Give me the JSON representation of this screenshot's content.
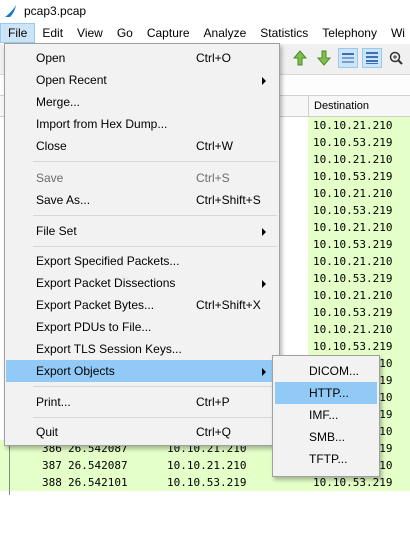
{
  "window": {
    "title": "pcap3.pcap"
  },
  "menubar": {
    "items": [
      "File",
      "Edit",
      "View",
      "Go",
      "Capture",
      "Analyze",
      "Statistics",
      "Telephony",
      "Wi"
    ],
    "active_index": 0
  },
  "packet_list": {
    "destination_header": "Destination",
    "destinations": [
      "10.10.21.210",
      "10.10.53.219",
      "10.10.21.210",
      "10.10.53.219",
      "10.10.21.210",
      "10.10.53.219",
      "10.10.21.210",
      "10.10.53.219",
      "10.10.21.210",
      "10.10.53.219",
      "10.10.21.210",
      "10.10.53.219",
      "10.10.21.210",
      "10.10.53.219",
      "10.10.21.210",
      "10.10.53.219",
      "10.10.21.210",
      "10.10.53.219",
      "10.10.21.210",
      "10.10.53.219",
      "10.10.21.210"
    ],
    "visible_rows": [
      {
        "no": "386",
        "time": "26.542087",
        "source": "10.10.21.210"
      },
      {
        "no": "387",
        "time": "26.542087",
        "source": "10.10.21.210"
      },
      {
        "no": "388",
        "time": "26.542101",
        "source": "10.10.53.219"
      }
    ],
    "row_color": "#e4ffc7"
  },
  "file_menu": {
    "items": [
      {
        "label": "Open",
        "shortcut": "Ctrl+O"
      },
      {
        "label": "Open Recent",
        "submenu": true
      },
      {
        "label": "Merge..."
      },
      {
        "label": "Import from Hex Dump..."
      },
      {
        "label": "Close",
        "shortcut": "Ctrl+W"
      },
      {
        "label": "Save",
        "shortcut": "Ctrl+S",
        "disabled": true
      },
      {
        "label": "Save As...",
        "shortcut": "Ctrl+Shift+S"
      },
      {
        "label": "File Set",
        "submenu": true
      },
      {
        "label": "Export Specified Packets..."
      },
      {
        "label": "Export Packet Dissections",
        "submenu": true
      },
      {
        "label": "Export Packet Bytes...",
        "shortcut": "Ctrl+Shift+X"
      },
      {
        "label": "Export PDUs to File..."
      },
      {
        "label": "Export TLS Session Keys..."
      },
      {
        "label": "Export Objects",
        "submenu": true,
        "highlighted": true
      },
      {
        "label": "Print...",
        "shortcut": "Ctrl+P"
      },
      {
        "label": "Quit",
        "shortcut": "Ctrl+Q"
      }
    ]
  },
  "export_objects_submenu": {
    "items": [
      {
        "label": "DICOM..."
      },
      {
        "label": "HTTP...",
        "highlighted": true
      },
      {
        "label": "IMF..."
      },
      {
        "label": "SMB..."
      },
      {
        "label": "TFTP..."
      }
    ]
  },
  "colors": {
    "highlight": "#91c9f7",
    "menu_bg": "#f2f2f2",
    "active_menu": "#cce4f7"
  },
  "icons": [
    "wireshark-fin-icon",
    "go-up-icon",
    "go-down-icon",
    "autoscroll-icon",
    "colorize-icon",
    "zoom-in-icon"
  ]
}
